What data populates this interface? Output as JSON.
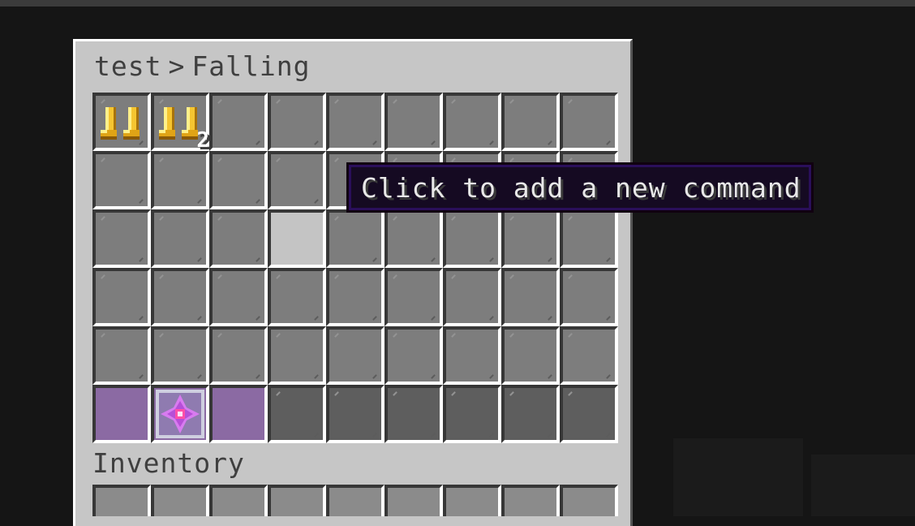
{
  "gui": {
    "breadcrumb": {
      "parent": "test",
      "separator": ">",
      "current": "Falling"
    },
    "inventory_label": "Inventory"
  },
  "tooltip": {
    "text": "Click to add a new command"
  },
  "slots": {
    "boots_1": {
      "icon": "golden-boots-icon",
      "count": ""
    },
    "boots_2": {
      "icon": "golden-boots-icon",
      "count": "2"
    },
    "crystal": {
      "icon": "purple-crystal-icon"
    }
  },
  "colors": {
    "panel": "#c6c6c6",
    "slot": "#8b8b8b",
    "tooltip_bg": "#150a22",
    "tooltip_border": "#2a0f5a",
    "accent_purple": "#8b6aa3"
  }
}
